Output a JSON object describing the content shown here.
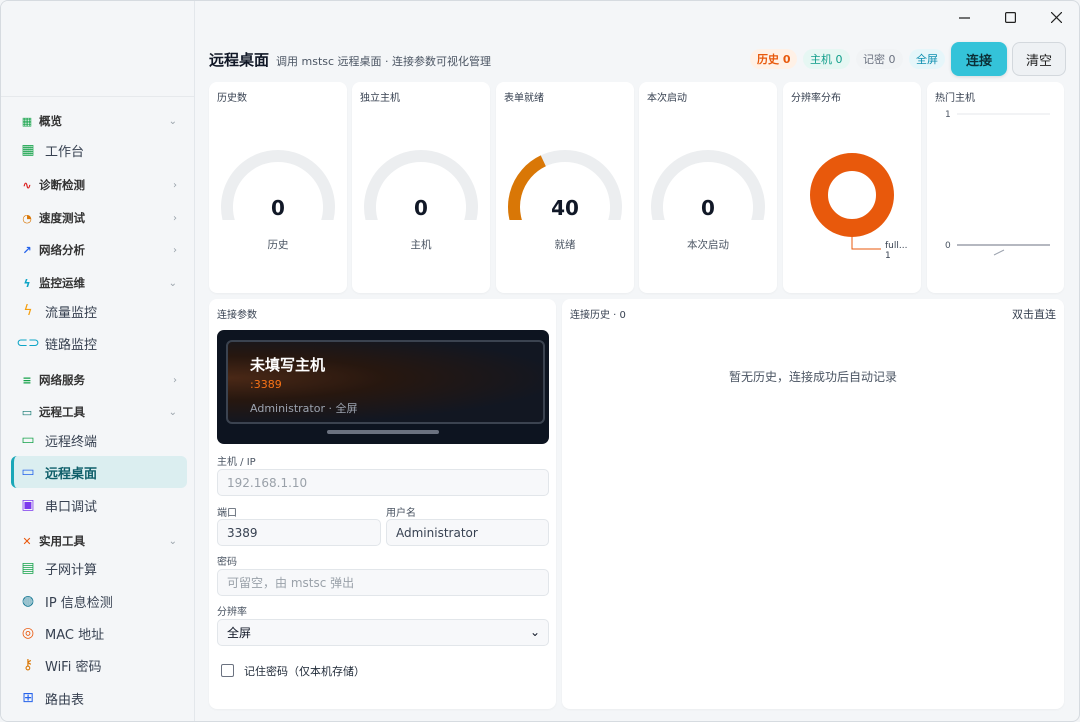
{
  "window": {
    "minimize_icon": "minimize-icon",
    "maximize_icon": "maximize-icon",
    "close_icon": "close-icon"
  },
  "sidebar": {
    "groups": [
      {
        "label": "概览",
        "icon": "grid-icon",
        "expanded": true,
        "items": [
          {
            "label": "工作台",
            "icon": "dashboard-icon"
          }
        ]
      },
      {
        "label": "诊断检测",
        "icon": "pulse-icon",
        "expanded": false,
        "items": []
      },
      {
        "label": "速度测试",
        "icon": "speedometer-icon",
        "expanded": false,
        "items": []
      },
      {
        "label": "网络分析",
        "icon": "trend-icon",
        "expanded": false,
        "items": []
      },
      {
        "label": "监控运维",
        "icon": "bolt-icon",
        "expanded": true,
        "items": [
          {
            "label": "流量监控",
            "icon": "lightning-icon"
          },
          {
            "label": "链路监控",
            "icon": "link-icon"
          }
        ]
      },
      {
        "label": "网络服务",
        "icon": "database-icon",
        "expanded": false,
        "items": []
      },
      {
        "label": "远程工具",
        "icon": "terminal-icon",
        "expanded": true,
        "items": [
          {
            "label": "远程终端",
            "icon": "terminal-icon"
          },
          {
            "label": "远程桌面",
            "icon": "monitor-icon",
            "active": true
          },
          {
            "label": "串口调试",
            "icon": "chip-icon"
          }
        ]
      },
      {
        "label": "实用工具",
        "icon": "tools-icon",
        "expanded": true,
        "items": [
          {
            "label": "子网计算",
            "icon": "calculator-icon"
          },
          {
            "label": "IP 信息检测",
            "icon": "globe-icon"
          },
          {
            "label": "MAC 地址",
            "icon": "fingerprint-icon"
          },
          {
            "label": "WiFi 密码",
            "icon": "key-icon"
          },
          {
            "label": "路由表",
            "icon": "map-icon"
          }
        ]
      }
    ]
  },
  "header": {
    "title": "远程桌面",
    "subtitle": "调用 mstsc 远程桌面 · 连接参数可视化管理",
    "pills": [
      {
        "label": "历史 0",
        "color": "#e8590c",
        "bg": "#fff1e6",
        "bold": true
      },
      {
        "label": "主机 0",
        "color": "#0f9d8a",
        "bg": "#e6f7f3"
      },
      {
        "label": "记密 0",
        "color": "#6b7280",
        "bg": "#f1f3f5"
      },
      {
        "label": "全屏",
        "color": "#0e8fb0",
        "bg": "#e6f6fa"
      }
    ],
    "connect_label": "连接",
    "clear_label": "清空"
  },
  "stats": [
    {
      "title": "历史数",
      "value": "0",
      "label": "历史",
      "fraction": 0
    },
    {
      "title": "独立主机",
      "value": "0",
      "label": "主机",
      "fraction": 0
    },
    {
      "title": "表单就绪",
      "value": "40",
      "label": "就绪",
      "fraction": 0.4
    },
    {
      "title": "本次启动",
      "value": "0",
      "label": "本次启动",
      "fraction": 0
    }
  ],
  "resolution_card": {
    "title": "分辨率分布",
    "slice_label": "full...",
    "slice_value": "1",
    "color": "#e8590c"
  },
  "hot_hosts_card": {
    "title": "热门主机",
    "y_max": "1",
    "y_min": "0"
  },
  "connection": {
    "title": "连接参数",
    "preview": {
      "host": "未填写主机",
      "port": ":3389",
      "meta": "Administrator · 全屏"
    },
    "host_label": "主机 / IP",
    "host_placeholder": "192.168.1.10",
    "port_label": "端口",
    "port_value": "3389",
    "user_label": "用户名",
    "user_value": "Administrator",
    "password_label": "密码",
    "password_placeholder": "可留空，由 mstsc 弹出",
    "resolution_label": "分辨率",
    "resolution_value": "全屏",
    "remember_label": "记住密码（仅本机存储）"
  },
  "history": {
    "title": "连接历史 · 0",
    "action": "双击直连",
    "empty": "暂无历史，连接成功后自动记录"
  },
  "chart_data": [
    {
      "type": "pie",
      "title": "分辨率分布",
      "categories": [
        "full..."
      ],
      "values": [
        1
      ]
    },
    {
      "type": "line",
      "title": "热门主机",
      "ylim": [
        0,
        1
      ],
      "series": []
    }
  ]
}
